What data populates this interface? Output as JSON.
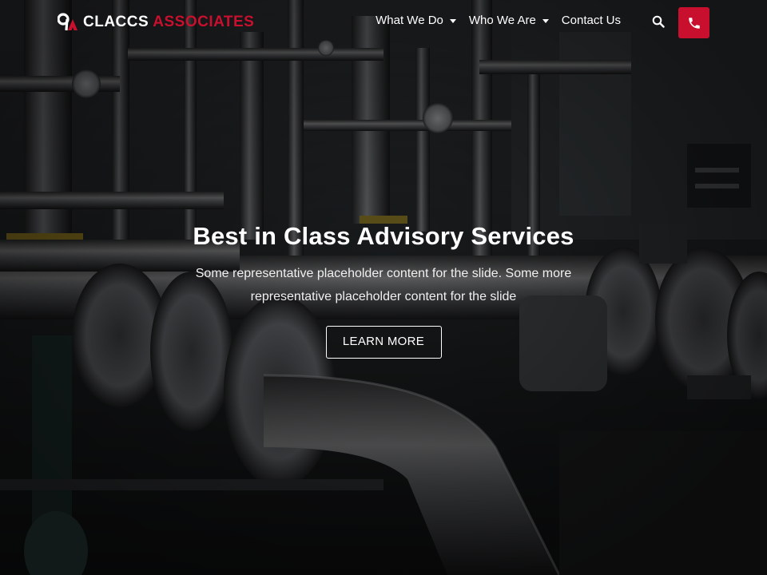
{
  "brand": {
    "mark_icon": "claccs-logo-icon",
    "name_primary": "CLACCS",
    "name_secondary": "ASSOCIATES",
    "accent_color": "#c8102e"
  },
  "nav": {
    "items": [
      {
        "label": "What We Do",
        "has_dropdown": true
      },
      {
        "label": "Who We Are",
        "has_dropdown": true
      },
      {
        "label": "Contact Us",
        "has_dropdown": false
      }
    ],
    "search_icon": "search-icon",
    "phone_icon": "phone-icon"
  },
  "hero": {
    "title": "Best in Class Advisory Services",
    "text": "Some representative placeholder content for the slide. Some more representative placeholder content for the slide",
    "button_label": "LEARN MORE",
    "background": "industrial-pipes-photo"
  }
}
